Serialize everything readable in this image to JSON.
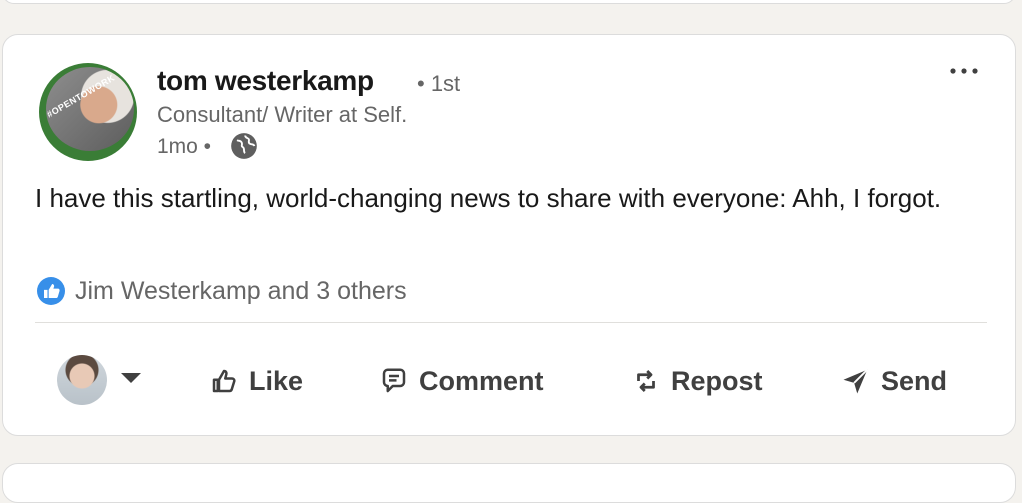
{
  "post": {
    "author": {
      "name": "tom westerkamp",
      "degree": "• 1st",
      "headline": "Consultant/ Writer at Self.",
      "time": "1mo •",
      "badge": "#OPENTOWORK"
    },
    "text": "I have this startling, world-changing news to share with everyone: Ahh, I forgot.",
    "reactions": {
      "text": "Jim Westerkamp and 3 others",
      "icon": "like-reaction-icon"
    }
  },
  "actions": {
    "like": "Like",
    "comment": "Comment",
    "repost": "Repost",
    "send": "Send"
  },
  "colors": {
    "reaction_blue": "#378fe9",
    "opentowork_green": "#3a7d36",
    "secondary_text": "#666666"
  }
}
